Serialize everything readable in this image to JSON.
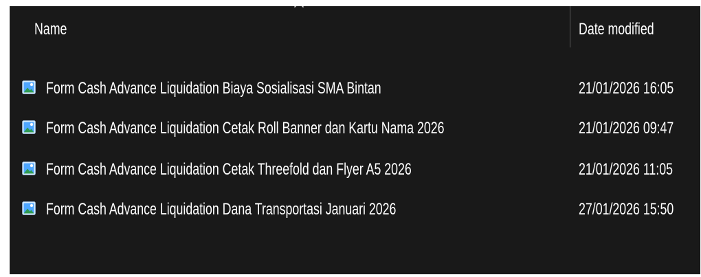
{
  "columns": {
    "name_label": "Name",
    "date_label": "Date modified"
  },
  "files": [
    {
      "name": "Form Cash Advance Liquidation Biaya Sosialisasi SMA Bintan",
      "date_modified": "21/01/2026 16:05",
      "icon": "image-file-icon"
    },
    {
      "name": "Form Cash Advance Liquidation Cetak Roll Banner dan Kartu Nama 2026",
      "date_modified": "21/01/2026 09:47",
      "icon": "image-file-icon"
    },
    {
      "name": "Form Cash Advance Liquidation Cetak Threefold dan Flyer A5 2026",
      "date_modified": "21/01/2026 11:05",
      "icon": "image-file-icon"
    },
    {
      "name": "Form Cash Advance Liquidation Dana Transportasi Januari 2026",
      "date_modified": "27/01/2026 15:50",
      "icon": "image-file-icon"
    }
  ],
  "icons": {
    "sort": "chevron-up-icon",
    "file": "image-file-icon"
  },
  "colors": {
    "background": "#191919",
    "text": "#ffffff",
    "divider": "#5a5a5a",
    "icon_frame": "#dcefff",
    "icon_sky": "#4ea6ff",
    "icon_mountain": "#2f9a52"
  }
}
